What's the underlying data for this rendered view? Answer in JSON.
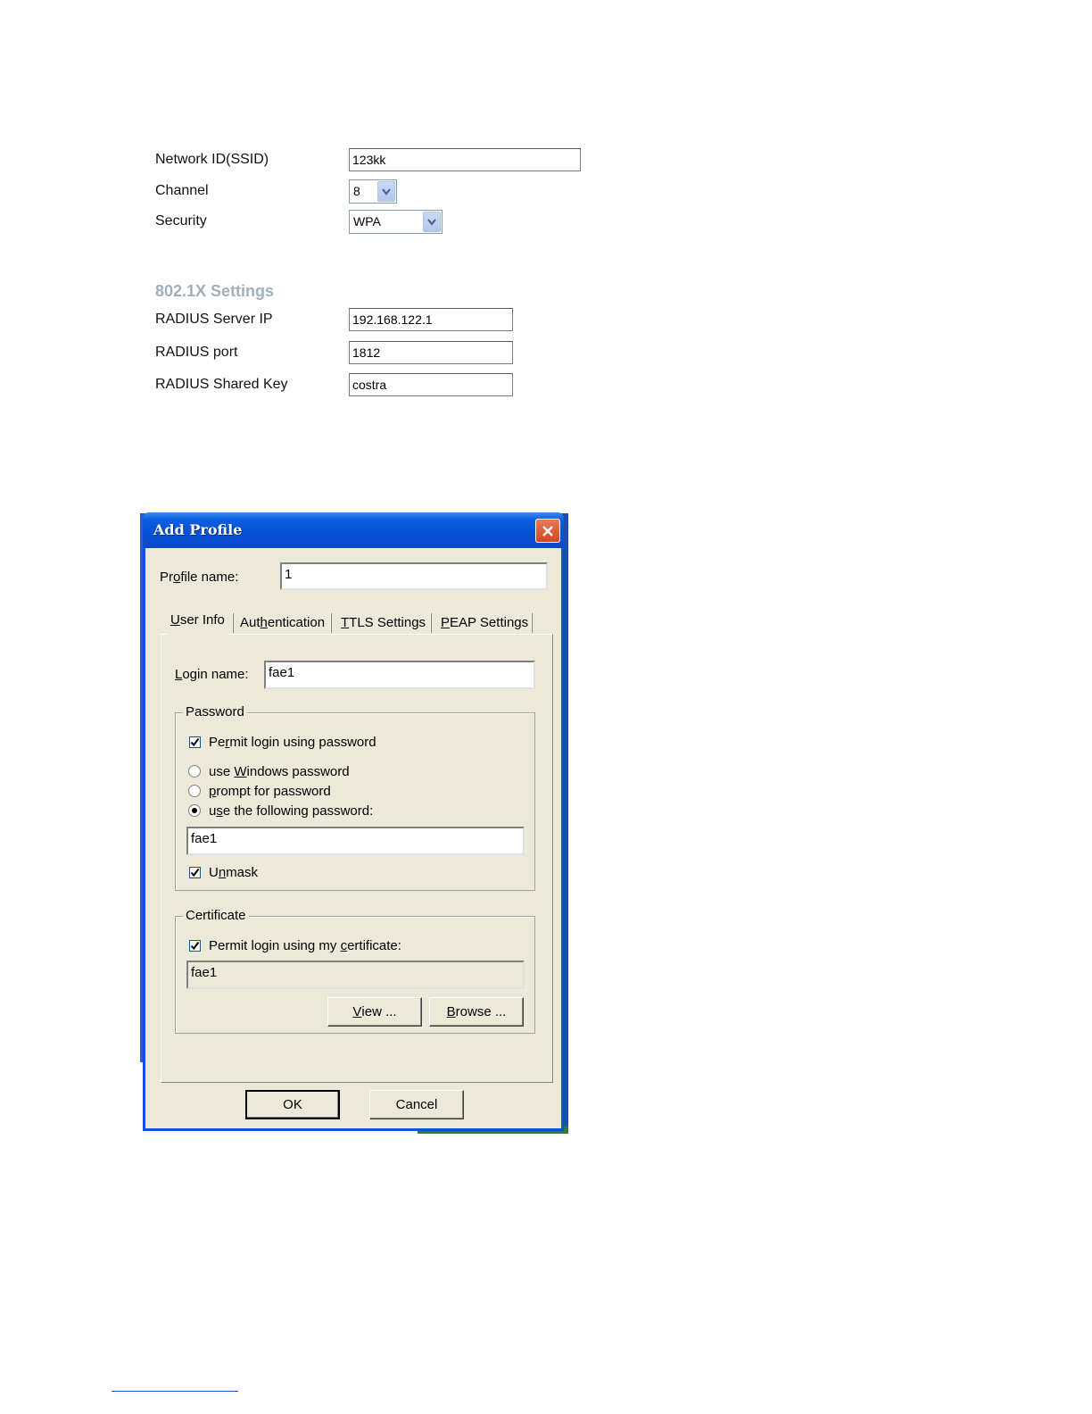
{
  "web_form": {
    "ssid_label": "Network ID(SSID)",
    "ssid_value": "123kk",
    "channel_label": "Channel",
    "channel_value": "8",
    "security_label": "Security",
    "security_value": "WPA",
    "section_title": "802.1X Settings",
    "radius_ip_label": "RADIUS Server IP",
    "radius_ip_value": "192.168.122.1",
    "radius_port_label": "RADIUS port",
    "radius_port_value": "1812",
    "radius_key_label": "RADIUS Shared Key",
    "radius_key_value": "costra"
  },
  "dialog": {
    "title": "Add Profile",
    "profile_name_label": [
      "Pr",
      "o",
      "file name:"
    ],
    "profile_name_value": "1",
    "tabs": [
      {
        "pre": "",
        "key": "U",
        "post": "ser Info"
      },
      {
        "pre": "Aut",
        "key": "h",
        "post": "entication"
      },
      {
        "pre": "",
        "key": "T",
        "post": "TLS Settings"
      },
      {
        "pre": "",
        "key": "P",
        "post": "EAP Settings"
      }
    ],
    "login_label": [
      "",
      "L",
      "ogin name:"
    ],
    "login_value": "fae1",
    "password_group": "Password",
    "permit_password": [
      "Pe",
      "r",
      "mit login using password"
    ],
    "use_windows": [
      "use ",
      "W",
      "indows password"
    ],
    "prompt_password": [
      "",
      "p",
      "rompt for password"
    ],
    "use_following": [
      "u",
      "s",
      "e the following password:"
    ],
    "password_value": "fae1",
    "unmask": [
      "U",
      "n",
      "mask"
    ],
    "certificate_group": "Certificate",
    "permit_cert": [
      "Permit login using my ",
      "c",
      "ertificate:"
    ],
    "certificate_value": "fae1",
    "view_button": [
      "",
      "V",
      "iew ..."
    ],
    "browse_button": [
      "",
      "B",
      "rowse ..."
    ],
    "ok_button": "OK",
    "cancel_button": "Cancel"
  }
}
